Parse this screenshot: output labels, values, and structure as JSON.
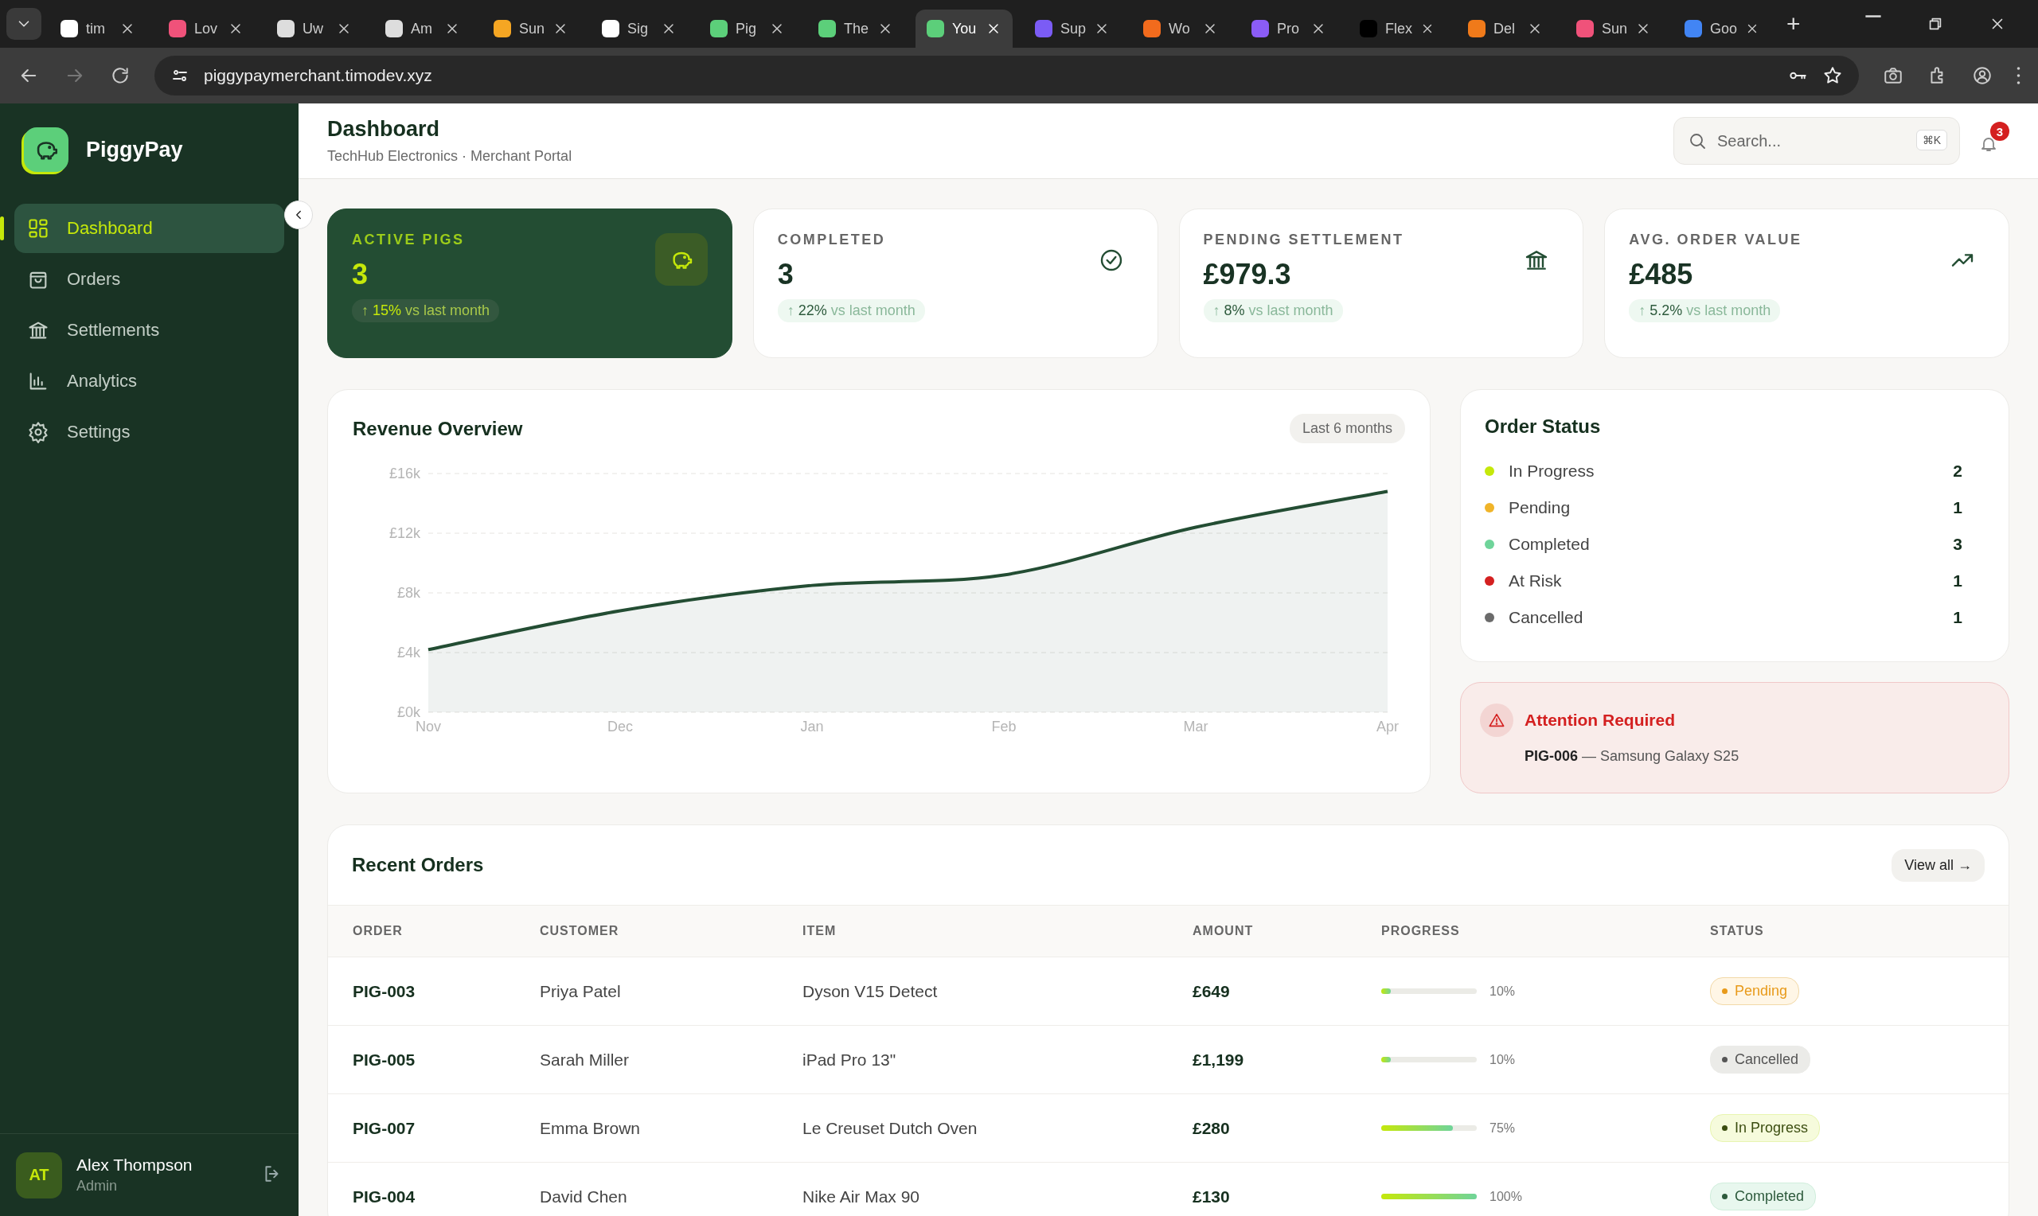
{
  "browser": {
    "tabs": [
      {
        "title": "tim",
        "color": "#ffffff",
        "selected": false
      },
      {
        "title": "Lov",
        "color": "#f0527a",
        "selected": false
      },
      {
        "title": "Uw",
        "color": "#dddddd",
        "selected": false
      },
      {
        "title": "Am",
        "color": "#dddddd",
        "selected": false
      },
      {
        "title": "Sun",
        "color": "#f5a623",
        "selected": false
      },
      {
        "title": "Sig",
        "color": "#ffffff",
        "selected": false
      },
      {
        "title": "Pig",
        "color": "#5ccf7a",
        "selected": false
      },
      {
        "title": "The",
        "color": "#5ccf7a",
        "selected": false
      },
      {
        "title": "You",
        "color": "#5ccf7a",
        "selected": true
      },
      {
        "title": "Sup",
        "color": "#7b5cf5",
        "selected": false
      },
      {
        "title": "Wo",
        "color": "#f26b1d",
        "selected": false
      },
      {
        "title": "Pro",
        "color": "#8b5cf6",
        "selected": false
      },
      {
        "title": "Flex",
        "color": "#000000",
        "selected": false
      },
      {
        "title": "Del",
        "color": "#f07a1a",
        "selected": false
      },
      {
        "title": "Sun",
        "color": "#f0527a",
        "selected": false
      },
      {
        "title": "Goo",
        "color": "#4285f4",
        "selected": false
      }
    ],
    "new_tab": "+",
    "url": "piggypaymerchant.timodev.xyz"
  },
  "sidebar": {
    "logo": "PiggyPay",
    "items": [
      {
        "label": "Dashboard",
        "selected": true
      },
      {
        "label": "Orders",
        "selected": false
      },
      {
        "label": "Settlements",
        "selected": false
      },
      {
        "label": "Analytics",
        "selected": false
      },
      {
        "label": "Settings",
        "selected": false
      }
    ],
    "user": {
      "initials": "AT",
      "name": "Alex Thompson",
      "role": "Admin"
    }
  },
  "header": {
    "title": "Dashboard",
    "subtitle": "TechHub Electronics · Merchant Portal",
    "search": {
      "placeholder": "Search...",
      "shortcut": "⌘K"
    },
    "notifications": "3"
  },
  "stats": [
    {
      "kind": "featured",
      "label": "ACTIVE PIGS",
      "value": "3",
      "trend": "↑ **15%** vs last month"
    },
    {
      "kind": "plain",
      "label": "COMPLETED",
      "value": "3",
      "trend": "↑ **22%** vs last month"
    },
    {
      "kind": "plain",
      "label": "PENDING SETTLEMENT",
      "value": "£979.3",
      "trend": "↑ **8%** vs last month"
    },
    {
      "kind": "plain",
      "label": "AVG. ORDER VALUE",
      "value": "£485",
      "trend": "↑ **5.2%** vs last month"
    }
  ],
  "revenue": {
    "title": "Revenue Overview",
    "range": "Last 6 months",
    "chart_data": {
      "type": "area",
      "categories": [
        "Nov",
        "Dec",
        "Jan",
        "Feb",
        "Mar",
        "Apr"
      ],
      "series": [
        {
          "color": "#234d33",
          "values": [
            4200,
            6800,
            8500,
            9200,
            12400,
            14800
          ]
        }
      ],
      "grid": true,
      "ylim": [
        0,
        16000
      ],
      "yticks": [
        {
          "value": 0,
          "label": "£0k"
        },
        {
          "value": 4000,
          "label": "£4k"
        },
        {
          "value": 8000,
          "label": "£8k"
        },
        {
          "value": 12000,
          "label": "£12k"
        },
        {
          "value": 16000,
          "label": "£16k"
        }
      ]
    }
  },
  "order_status": {
    "title": "Order Status",
    "items": [
      {
        "label": "In Progress",
        "count": "2",
        "color": "#c5e80a"
      },
      {
        "label": "Pending",
        "count": "1",
        "color": "#f0b429"
      },
      {
        "label": "Completed",
        "count": "3",
        "color": "#6fd49a"
      },
      {
        "label": "At Risk",
        "count": "1",
        "color": "#d42020"
      },
      {
        "label": "Cancelled",
        "count": "1",
        "color": "#6b6b6b"
      }
    ]
  },
  "alert": {
    "title": "Attention Required",
    "text": "**PIG-006** — Samsung Galaxy S25"
  },
  "recent_orders": {
    "title": "Recent Orders",
    "view_all": "View all →",
    "columns": [
      "ORDER",
      "CUSTOMER",
      "ITEM",
      "AMOUNT",
      "PROGRESS",
      "STATUS"
    ],
    "rows": [
      {
        "order": "PIG-003",
        "customer": "Priya Patel",
        "item": "Dyson V15 Detect",
        "amount": "£649",
        "level": 0.1,
        "progress": "10%",
        "status": "Pending",
        "kind": "pending"
      },
      {
        "order": "PIG-005",
        "customer": "Sarah Miller",
        "item": "iPad Pro 13\"",
        "amount": "£1,199",
        "level": 0.1,
        "progress": "10%",
        "status": "Cancelled",
        "kind": "cancelled"
      },
      {
        "order": "PIG-007",
        "customer": "Emma Brown",
        "item": "Le Creuset Dutch Oven",
        "amount": "£280",
        "level": 0.75,
        "progress": "75%",
        "status": "In Progress",
        "kind": "in_progress"
      },
      {
        "order": "PIG-004",
        "customer": "David Chen",
        "item": "Nike Air Max 90",
        "amount": "£130",
        "level": 1,
        "progress": "100%",
        "status": "Completed",
        "kind": "completed"
      }
    ]
  }
}
